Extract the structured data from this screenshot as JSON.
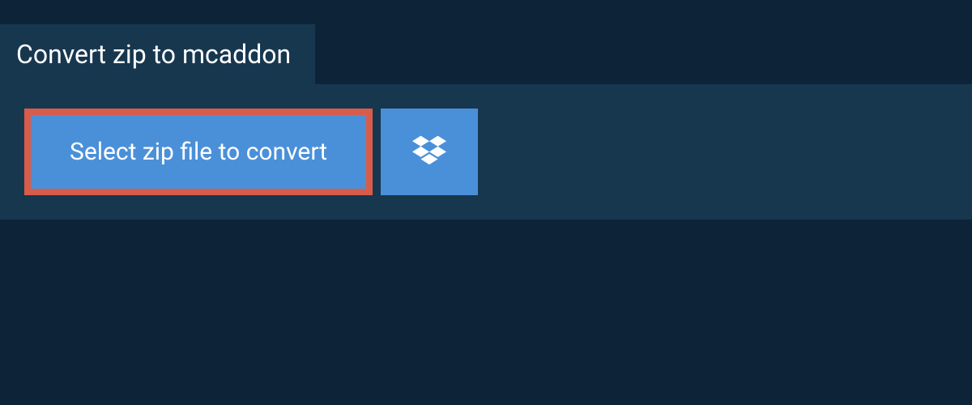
{
  "header": {
    "title": "Convert zip to mcaddon"
  },
  "actions": {
    "select_file_label": "Select zip file to convert",
    "dropbox_icon": "dropbox-icon"
  }
}
